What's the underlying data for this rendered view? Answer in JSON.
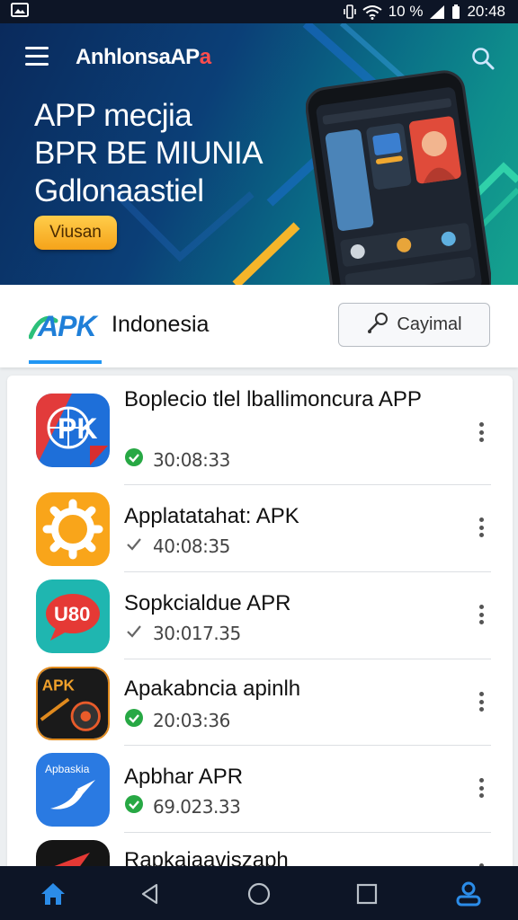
{
  "status_bar": {
    "time": "20:48",
    "battery_label": "10 %"
  },
  "header": {
    "brand_main": "AnhlonsaAP",
    "brand_accent": "a"
  },
  "hero": {
    "lines": [
      "APP mecjia",
      "BPR BE MIUNIA",
      "Gdlonaastiel"
    ],
    "cta_label": "Viusan"
  },
  "appbar": {
    "logo_text": "APK",
    "title": "Indonesia",
    "download_label": "Cayimal"
  },
  "apps": [
    {
      "name": "Boplecio tlel lballimoncura APP",
      "meta": "30:08:33",
      "status": "verified",
      "icon": "pk-globe-icon"
    },
    {
      "name": "Applatatahat: APK",
      "meta": "40:08:35",
      "status": "pending",
      "icon": "gear-icon"
    },
    {
      "name": "Sopkcialdue APR",
      "meta": "30:017.35",
      "status": "pending",
      "icon": "chat-bubble-icon"
    },
    {
      "name": "Apakabncia apinlh",
      "meta": "20:03:36",
      "status": "verified",
      "icon": "game-icon"
    },
    {
      "name": "Apbhar APR",
      "meta": "69.023.33",
      "status": "verified",
      "icon": "paper-plane-icon"
    },
    {
      "name": "Rapkajaaviszaph",
      "meta": "",
      "status": "",
      "icon": "red-arrow-icon"
    }
  ],
  "colors": {
    "accent": "#2196f3",
    "verified": "#27a844",
    "cta": "#f5a31a",
    "brand_accent": "#ff4d4d"
  }
}
